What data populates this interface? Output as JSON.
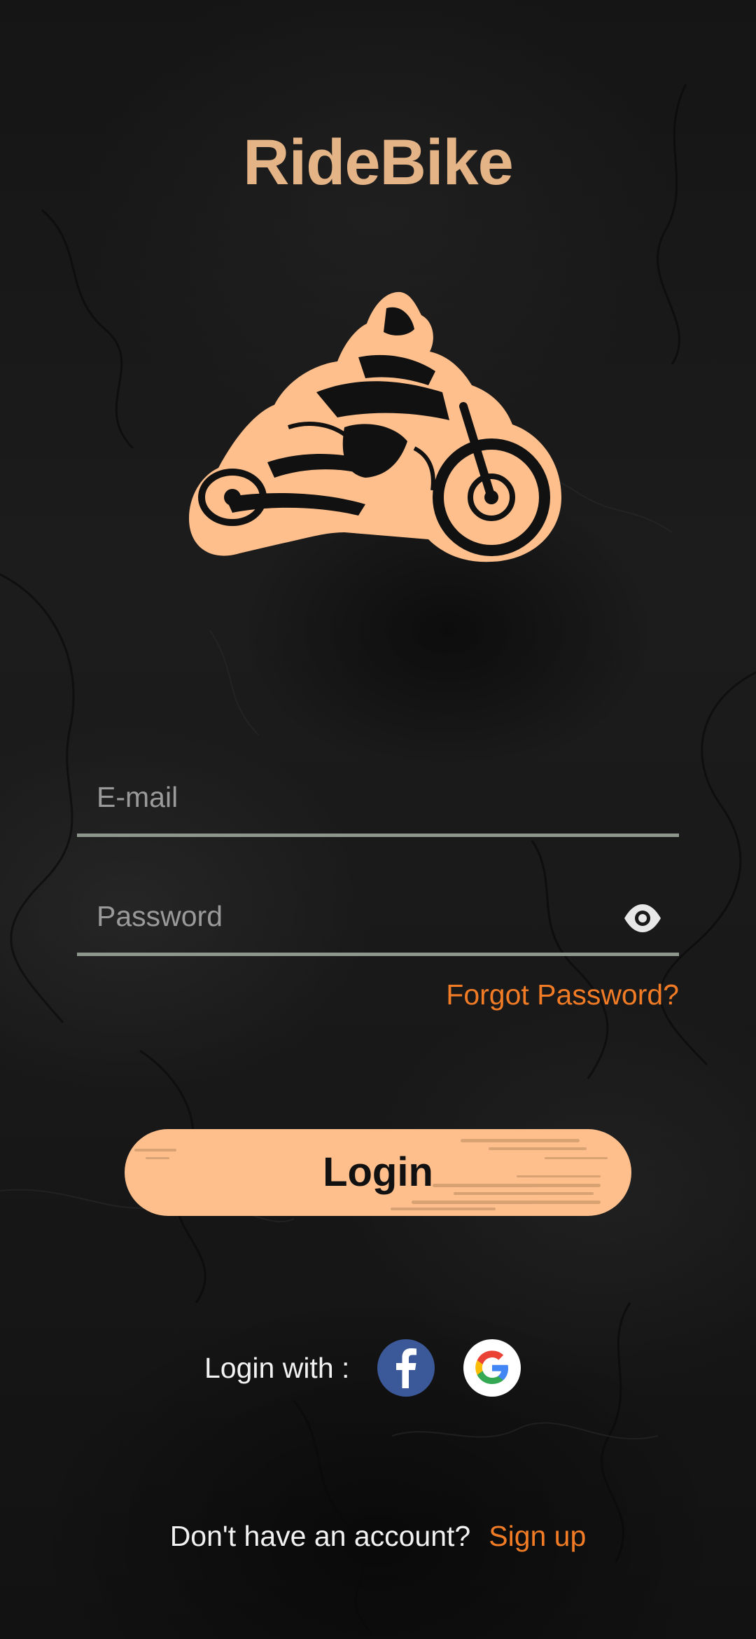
{
  "app": {
    "title": "RideBike"
  },
  "logo": {
    "icon": "motorcycle-rider-icon",
    "color": "#ffbf8c"
  },
  "form": {
    "email": {
      "value": "",
      "placeholder": "E-mail"
    },
    "password": {
      "value": "",
      "placeholder": "Password",
      "toggle_icon": "eye-icon"
    },
    "forgot_password_label": "Forgot Password?",
    "login_button_label": "Login"
  },
  "social_login": {
    "label": "Login with :",
    "providers": [
      {
        "name": "facebook",
        "icon": "facebook-icon",
        "color": "#3b5998"
      },
      {
        "name": "google",
        "icon": "google-icon",
        "color": "#ffffff"
      }
    ]
  },
  "signup": {
    "prompt": "Don't have an account?",
    "link_label": "Sign up"
  },
  "colors": {
    "title": "#e4b386",
    "accent": "#f27c26",
    "button": "#ffbf8c",
    "underline": "#8e978c",
    "background": "#161616"
  }
}
